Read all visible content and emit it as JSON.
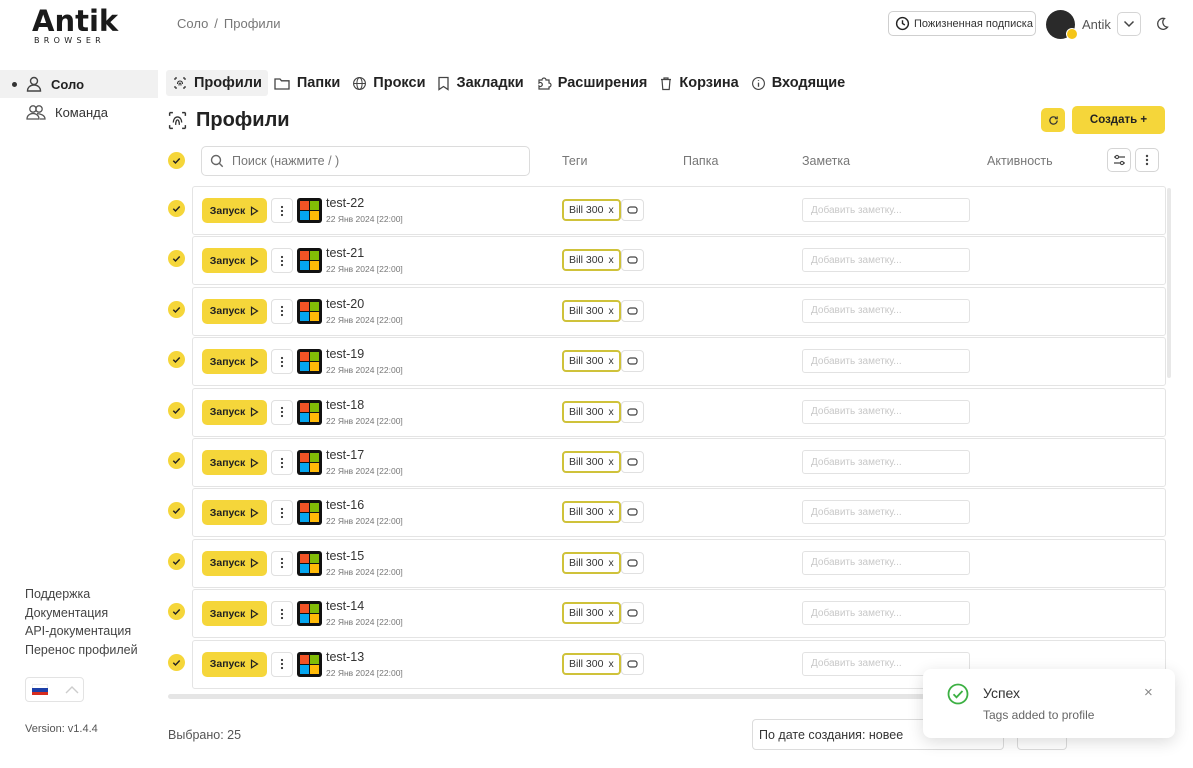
{
  "brand": {
    "name": "Antik",
    "sub": "BROWSER"
  },
  "breadcrumb": {
    "root": "Соло",
    "sep": "/",
    "current": "Профили"
  },
  "header": {
    "subscription_label": "Пожизненная подписка",
    "user_name": "Antik"
  },
  "sidebar": {
    "items": [
      {
        "label": "Соло",
        "icon": "user-icon",
        "active": true
      },
      {
        "label": "Команда",
        "icon": "users-icon",
        "active": false
      }
    ],
    "links": [
      "Поддержка",
      "Документация",
      "API-документация",
      "Перенос профилей"
    ],
    "version": "Version: v1.4.4"
  },
  "tabs": [
    {
      "label": "Профили",
      "icon": "fingerprint-icon",
      "active": true
    },
    {
      "label": "Папки",
      "icon": "folder-icon"
    },
    {
      "label": "Прокси",
      "icon": "globe-icon"
    },
    {
      "label": "Закладки",
      "icon": "bookmark-icon"
    },
    {
      "label": "Расширения",
      "icon": "puzzle-icon"
    },
    {
      "label": "Корзина",
      "icon": "trash-icon"
    },
    {
      "label": "Входящие",
      "icon": "info-icon"
    }
  ],
  "page": {
    "title": "Профили",
    "create_label": "Создать +"
  },
  "search": {
    "placeholder": "Поиск (нажмите / )"
  },
  "columns": {
    "tags": "Теги",
    "folder": "Папка",
    "note": "Заметка",
    "activity": "Активность"
  },
  "note_placeholder": "Добавить заметку...",
  "launch_label": "Запуск",
  "profiles": [
    {
      "name": "test-22",
      "date": "22 Янв 2024 [22:00]",
      "tag": "Bill 300",
      "tag_remove": "x"
    },
    {
      "name": "test-21",
      "date": "22 Янв 2024 [22:00]",
      "tag": "Bill 300",
      "tag_remove": "x"
    },
    {
      "name": "test-20",
      "date": "22 Янв 2024 [22:00]",
      "tag": "Bill 300",
      "tag_remove": "x"
    },
    {
      "name": "test-19",
      "date": "22 Янв 2024 [22:00]",
      "tag": "Bill 300",
      "tag_remove": "x"
    },
    {
      "name": "test-18",
      "date": "22 Янв 2024 [22:00]",
      "tag": "Bill 300",
      "tag_remove": "x"
    },
    {
      "name": "test-17",
      "date": "22 Янв 2024 [22:00]",
      "tag": "Bill 300",
      "tag_remove": "x"
    },
    {
      "name": "test-16",
      "date": "22 Янв 2024 [22:00]",
      "tag": "Bill 300",
      "tag_remove": "x"
    },
    {
      "name": "test-15",
      "date": "22 Янв 2024 [22:00]",
      "tag": "Bill 300",
      "tag_remove": "x"
    },
    {
      "name": "test-14",
      "date": "22 Янв 2024 [22:00]",
      "tag": "Bill 300",
      "tag_remove": "x"
    },
    {
      "name": "test-13",
      "date": "22 Янв 2024 [22:00]",
      "tag": "Bill 300",
      "tag_remove": "x"
    }
  ],
  "footer": {
    "selected": "Выбрано: 25",
    "sort": "По дате создания: новее"
  },
  "toast": {
    "title": "Успех",
    "message": "Tags added to profile",
    "close": "×"
  },
  "colors": {
    "accent": "#f5d63a",
    "tag_border": "#cfc23a",
    "success": "#3cb043"
  }
}
